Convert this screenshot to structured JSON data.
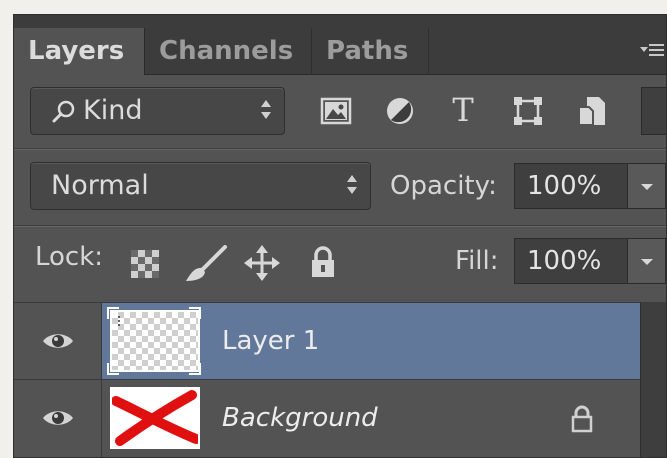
{
  "tabs": [
    {
      "label": "Layers",
      "active": true
    },
    {
      "label": "Channels",
      "active": false
    },
    {
      "label": "Paths",
      "active": false
    }
  ],
  "filter": {
    "kind_label": "Kind",
    "icons": [
      "image-filter-icon",
      "adjustment-filter-icon",
      "type-filter-icon",
      "shape-filter-icon",
      "smart-object-filter-icon"
    ]
  },
  "blend": {
    "mode": "Normal",
    "opacity_label": "Opacity:",
    "opacity_value": "100%"
  },
  "lock": {
    "label": "Lock:",
    "icons": [
      "lock-transparent-pixels-icon",
      "lock-image-pixels-icon",
      "lock-position-icon",
      "lock-all-icon"
    ],
    "fill_label": "Fill:",
    "fill_value": "100%"
  },
  "layers": [
    {
      "name": "Layer 1",
      "selected": true,
      "visible": true,
      "italic": false,
      "locked": false
    },
    {
      "name": "Background",
      "selected": false,
      "visible": true,
      "italic": true,
      "locked": true
    }
  ],
  "colors": {
    "panel": "#535353",
    "tabbar": "#3c3c3c",
    "selection": "#62789a",
    "background_thumb_stroke": "#e01010"
  }
}
